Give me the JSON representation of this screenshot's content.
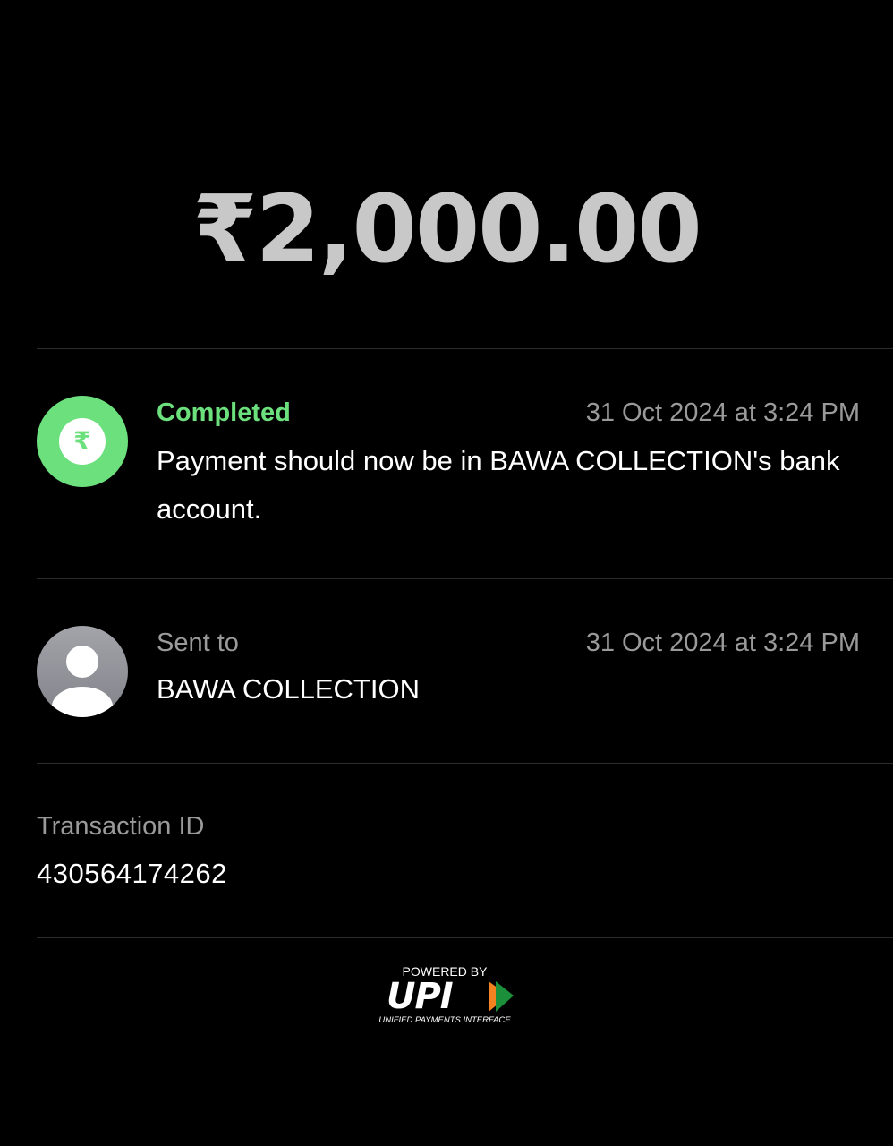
{
  "payment": {
    "amount": "₹2,000.00"
  },
  "status": {
    "icon": "rupee-icon",
    "label": "Completed",
    "timestamp": "31 Oct 2024 at 3:24 PM",
    "message": "Payment should now be in BAWA COLLECTION's bank account."
  },
  "recipient": {
    "icon": "user-icon",
    "label": "Sent to",
    "timestamp": "31 Oct 2024 at 3:24 PM",
    "name": "BAWA COLLECTION"
  },
  "transaction": {
    "label": "Transaction ID",
    "id": "430564174262"
  },
  "footer": {
    "powered_by": "POWERED BY",
    "brand": "UPI",
    "brand_subtitle": "UNIFIED PAYMENTS INTERFACE"
  },
  "colors": {
    "background": "#000000",
    "success": "#6ce07c",
    "muted_text": "#9a9a9a",
    "amount_text": "#c8c8c8"
  }
}
